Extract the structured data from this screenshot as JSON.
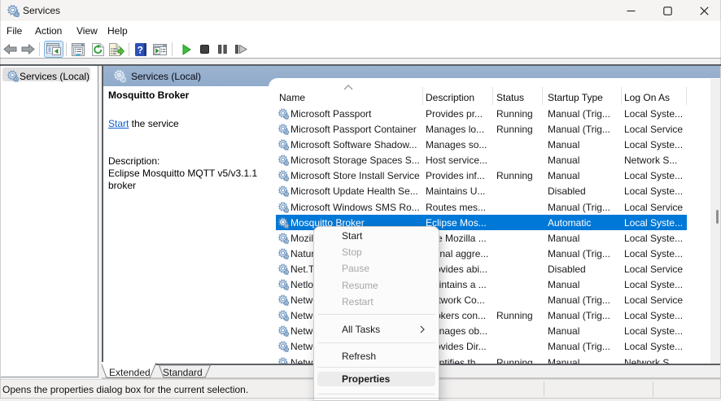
{
  "window": {
    "title": "Services",
    "controls": {
      "minimize": "minimize",
      "maximize": "maximize",
      "close": "close"
    }
  },
  "menu_bar": {
    "items": [
      "File",
      "Action",
      "View",
      "Help"
    ]
  },
  "toolbar": {
    "icons": [
      "back",
      "forward",
      "show-hide-console-tree",
      "properties",
      "refresh",
      "export-list",
      "help",
      "show-hide-action-pane",
      "start-service",
      "stop-service",
      "pause-service",
      "restart-service"
    ]
  },
  "tree": {
    "selected_item": "Services (Local)"
  },
  "pane": {
    "header": "Services (Local)",
    "description_panel": {
      "service_name": "Mosquitto Broker",
      "action_link": "Start",
      "action_suffix": " the service",
      "description_label": "Description:",
      "description_text": "Eclipse Mosquitto MQTT v5/v3.1.1 broker"
    },
    "list": {
      "columns": [
        "Name",
        "Description",
        "Status",
        "Startup Type",
        "Log On As"
      ],
      "sort": {
        "column": "Name",
        "direction": "ascending"
      },
      "rows": [
        {
          "name": "Microsoft Passport",
          "description": "Provides pr...",
          "status": "Running",
          "startup": "Manual (Trig...",
          "logon": "Local Syste...",
          "selected": false
        },
        {
          "name": "Microsoft Passport Container",
          "description": "Manages lo...",
          "status": "Running",
          "startup": "Manual (Trig...",
          "logon": "Local Service",
          "selected": false
        },
        {
          "name": "Microsoft Software Shadow...",
          "description": "Manages so...",
          "status": "",
          "startup": "Manual",
          "logon": "Local Syste...",
          "selected": false
        },
        {
          "name": "Microsoft Storage Spaces S...",
          "description": "Host service...",
          "status": "",
          "startup": "Manual",
          "logon": "Network S...",
          "selected": false
        },
        {
          "name": "Microsoft Store Install Service",
          "description": "Provides inf...",
          "status": "Running",
          "startup": "Manual",
          "logon": "Local Syste...",
          "selected": false
        },
        {
          "name": "Microsoft Update Health Se...",
          "description": "Maintains U...",
          "status": "",
          "startup": "Disabled",
          "logon": "Local Syste...",
          "selected": false
        },
        {
          "name": "Microsoft Windows SMS Ro...",
          "description": "Routes mes...",
          "status": "",
          "startup": "Manual (Trig...",
          "logon": "Local Service",
          "selected": false
        },
        {
          "name": "Mosquitto Broker",
          "description": "Eclipse Mos...",
          "status": "",
          "startup": "Automatic",
          "logon": "Local Syste...",
          "selected": true
        },
        {
          "name": "Mozilla Maintenance Service",
          "description": "The Mozilla ...",
          "status": "",
          "startup": "Manual",
          "logon": "Local Syste...",
          "selected": false
        },
        {
          "name": "Natural Authentication",
          "description": "Signal aggre...",
          "status": "",
          "startup": "Manual (Trig...",
          "logon": "Local Syste...",
          "selected": false
        },
        {
          "name": "Net.Tcp Port Sharing Service",
          "description": "Provides abi...",
          "status": "",
          "startup": "Disabled",
          "logon": "Local Service",
          "selected": false
        },
        {
          "name": "Netlogon",
          "description": "Maintains a ...",
          "status": "",
          "startup": "Manual",
          "logon": "Local Syste...",
          "selected": false
        },
        {
          "name": "Network Connected Devices Auto-Setup",
          "description": "Network Co...",
          "status": "",
          "startup": "Manual (Trig...",
          "logon": "Local Service",
          "selected": false
        },
        {
          "name": "Network Connection Broker",
          "description": "Brokers con...",
          "status": "Running",
          "startup": "Manual (Trig...",
          "logon": "Local Syste...",
          "selected": false
        },
        {
          "name": "Network Connections",
          "description": "Manages ob...",
          "status": "",
          "startup": "Manual",
          "logon": "Local Syste...",
          "selected": false
        },
        {
          "name": "Network Connectivity Assistant",
          "description": "Provides Dir...",
          "status": "",
          "startup": "Manual (Trig...",
          "logon": "Local Syste...",
          "selected": false
        },
        {
          "name": "Network List Service",
          "description": "Identifies th...",
          "status": "Running",
          "startup": "Manual",
          "logon": "Network S...",
          "selected": false
        }
      ]
    }
  },
  "tabs": {
    "items": [
      {
        "label": "Extended",
        "selected": true
      },
      {
        "label": "Standard",
        "selected": false
      }
    ]
  },
  "status_bar": {
    "text": "Opens the properties dialog box for the current selection."
  },
  "context_menu": {
    "items": [
      {
        "type": "item",
        "label": "Start",
        "enabled": true
      },
      {
        "type": "item",
        "label": "Stop",
        "enabled": false
      },
      {
        "type": "item",
        "label": "Pause",
        "enabled": false
      },
      {
        "type": "item",
        "label": "Resume",
        "enabled": false
      },
      {
        "type": "item",
        "label": "Restart",
        "enabled": false
      },
      {
        "type": "separator"
      },
      {
        "type": "item",
        "label": "All Tasks",
        "enabled": true,
        "submenu": true
      },
      {
        "type": "separator"
      },
      {
        "type": "item",
        "label": "Refresh",
        "enabled": true
      },
      {
        "type": "separator"
      },
      {
        "type": "item",
        "label": "Properties",
        "enabled": true,
        "highlighted": true
      },
      {
        "type": "separator"
      }
    ]
  },
  "colors": {
    "accent_selection": "#0078d7",
    "band_blue": "#95aecb",
    "tree_highlight": "#dfdfdf"
  }
}
